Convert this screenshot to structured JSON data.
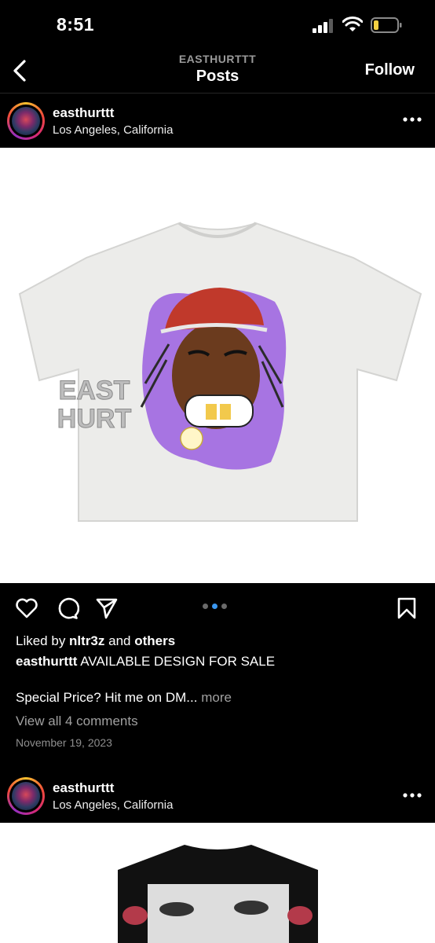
{
  "status_bar": {
    "time": "8:51"
  },
  "header": {
    "account": "EASTHURTTT",
    "title": "Posts",
    "follow_label": "Follow"
  },
  "post": {
    "username": "easthurttt",
    "location": "Los Angeles, California",
    "liked_prefix": "Liked by ",
    "liked_user": "nltr3z",
    "liked_and": " and ",
    "liked_others": "others",
    "caption_user": "easthurttt",
    "caption_text": " AVAILABLE DESIGN FOR SALE",
    "caption_line2": "Special Price? Hit me on DM... ",
    "more_label": "more",
    "comments_link": "View all 4 comments",
    "date": "November 19, 2023",
    "carousel": {
      "count": 3,
      "active": 2
    },
    "shirt_logo_text": "EAST HURT",
    "accent_colors": {
      "purple": "#9b5fe0",
      "cap_red": "#c0392b",
      "gold": "#f2c94c"
    }
  },
  "post2": {
    "username": "easthurttt",
    "location": "Los Angeles, California"
  },
  "icons": [
    "back-arrow-icon",
    "more-icon",
    "heart-icon",
    "comment-icon",
    "share-icon",
    "bookmark-icon"
  ]
}
